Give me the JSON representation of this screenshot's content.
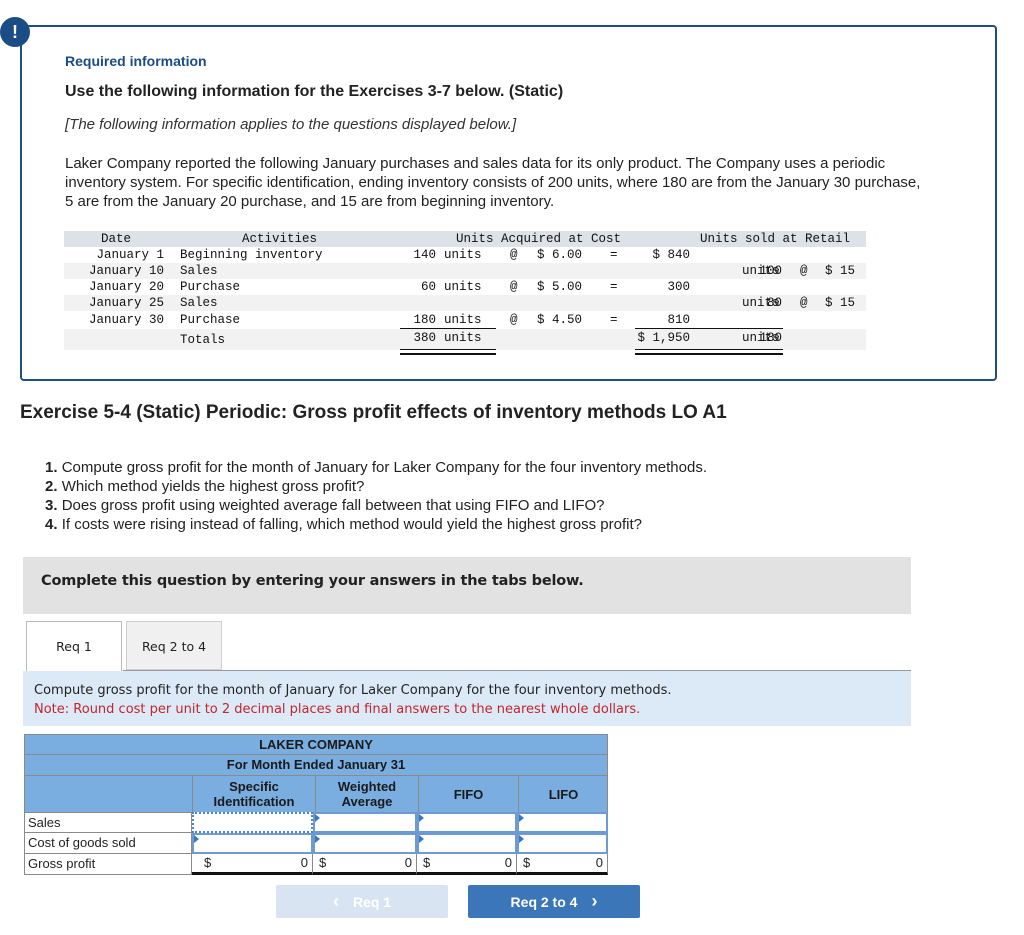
{
  "info_box": {
    "alert_icon": "!",
    "required_label": "Required information",
    "title": "Use the following information for the Exercises 3-7 below. (Static)",
    "applies_note": "[The following information applies to the questions displayed below.]",
    "intro_text": "Laker Company reported the following January purchases and sales data for its only product. The Company uses a periodic inventory system. For specific identification, ending inventory consists of 200 units, where 180 are from the January 30 purchase, 5 are from the January 20 purchase, and 15 are from beginning inventory."
  },
  "data_table": {
    "headers": {
      "date": "Date",
      "activities": "Activities",
      "acquired": "Units Acquired at Cost",
      "sold": "Units sold at Retail"
    },
    "rows": [
      {
        "date": "January 1",
        "activity": "Beginning inventory",
        "units": "140",
        "units_label": "units",
        "at": "@",
        "cost": "$ 6.00",
        "eq": "=",
        "total": "$ 840",
        "sold_units": "",
        "sold_label": "",
        "sold_at": "",
        "price": ""
      },
      {
        "date": "January 10",
        "activity": "Sales",
        "units": "",
        "units_label": "",
        "at": "",
        "cost": "",
        "eq": "",
        "total": "",
        "sold_units": "100",
        "sold_label": "units",
        "sold_at": "@",
        "price": "$ 15"
      },
      {
        "date": "January 20",
        "activity": "Purchase",
        "units": "60",
        "units_label": "units",
        "at": "@",
        "cost": "$ 5.00",
        "eq": "=",
        "total": "300",
        "sold_units": "",
        "sold_label": "",
        "sold_at": "",
        "price": ""
      },
      {
        "date": "January 25",
        "activity": "Sales",
        "units": "",
        "units_label": "",
        "at": "",
        "cost": "",
        "eq": "",
        "total": "",
        "sold_units": "80",
        "sold_label": "units",
        "sold_at": "@",
        "price": "$ 15"
      },
      {
        "date": "January 30",
        "activity": "Purchase",
        "units": "180",
        "units_label": "units",
        "at": "@",
        "cost": "$ 4.50",
        "eq": "=",
        "total": "810",
        "sold_units": "",
        "sold_label": "",
        "sold_at": "",
        "price": ""
      }
    ],
    "totals": {
      "label": "Totals",
      "units": "380",
      "units_label": "units",
      "total": "$ 1,950",
      "sold_units": "180",
      "sold_label": "units"
    }
  },
  "exercise": {
    "title": "Exercise 5-4 (Static) Periodic: Gross profit effects of inventory methods LO A1",
    "questions": [
      {
        "num": "1.",
        "text": "Compute gross profit for the month of January for Laker Company for the four inventory methods."
      },
      {
        "num": "2.",
        "text": "Which method yields the highest gross profit?"
      },
      {
        "num": "3.",
        "text": "Does gross profit using weighted average fall between that using FIFO and LIFO?"
      },
      {
        "num": "4.",
        "text": "If costs were rising instead of falling, which method would yield the highest gross profit?"
      }
    ]
  },
  "complete_banner": "Complete this question by entering your answers in the tabs below.",
  "tabs": [
    {
      "label": "Req 1",
      "active": true
    },
    {
      "label": "Req 2 to 4",
      "active": false
    }
  ],
  "instructions": {
    "text": "Compute gross profit for the month of January for Laker Company for the four inventory methods.",
    "note": "Note: Round cost per unit to 2 decimal places and final answers to the nearest whole dollars."
  },
  "answer_table": {
    "company": "LAKER COMPANY",
    "period": "For Month Ended January 31",
    "columns": [
      "Specific Identification",
      "Weighted Average",
      "FIFO",
      "LIFO"
    ],
    "rows": [
      {
        "label": "Sales",
        "values": [
          "",
          "",
          "",
          ""
        ]
      },
      {
        "label": "Cost of goods sold",
        "values": [
          "",
          "",
          "",
          ""
        ]
      }
    ],
    "gross_profit": {
      "label": "Gross profit",
      "currency": "$",
      "values": [
        "0",
        "0",
        "0",
        "0"
      ]
    }
  },
  "nav": {
    "prev_label": "Req 1",
    "next_label": "Req 2 to 4",
    "prev_icon": "‹",
    "next_icon": "›"
  }
}
